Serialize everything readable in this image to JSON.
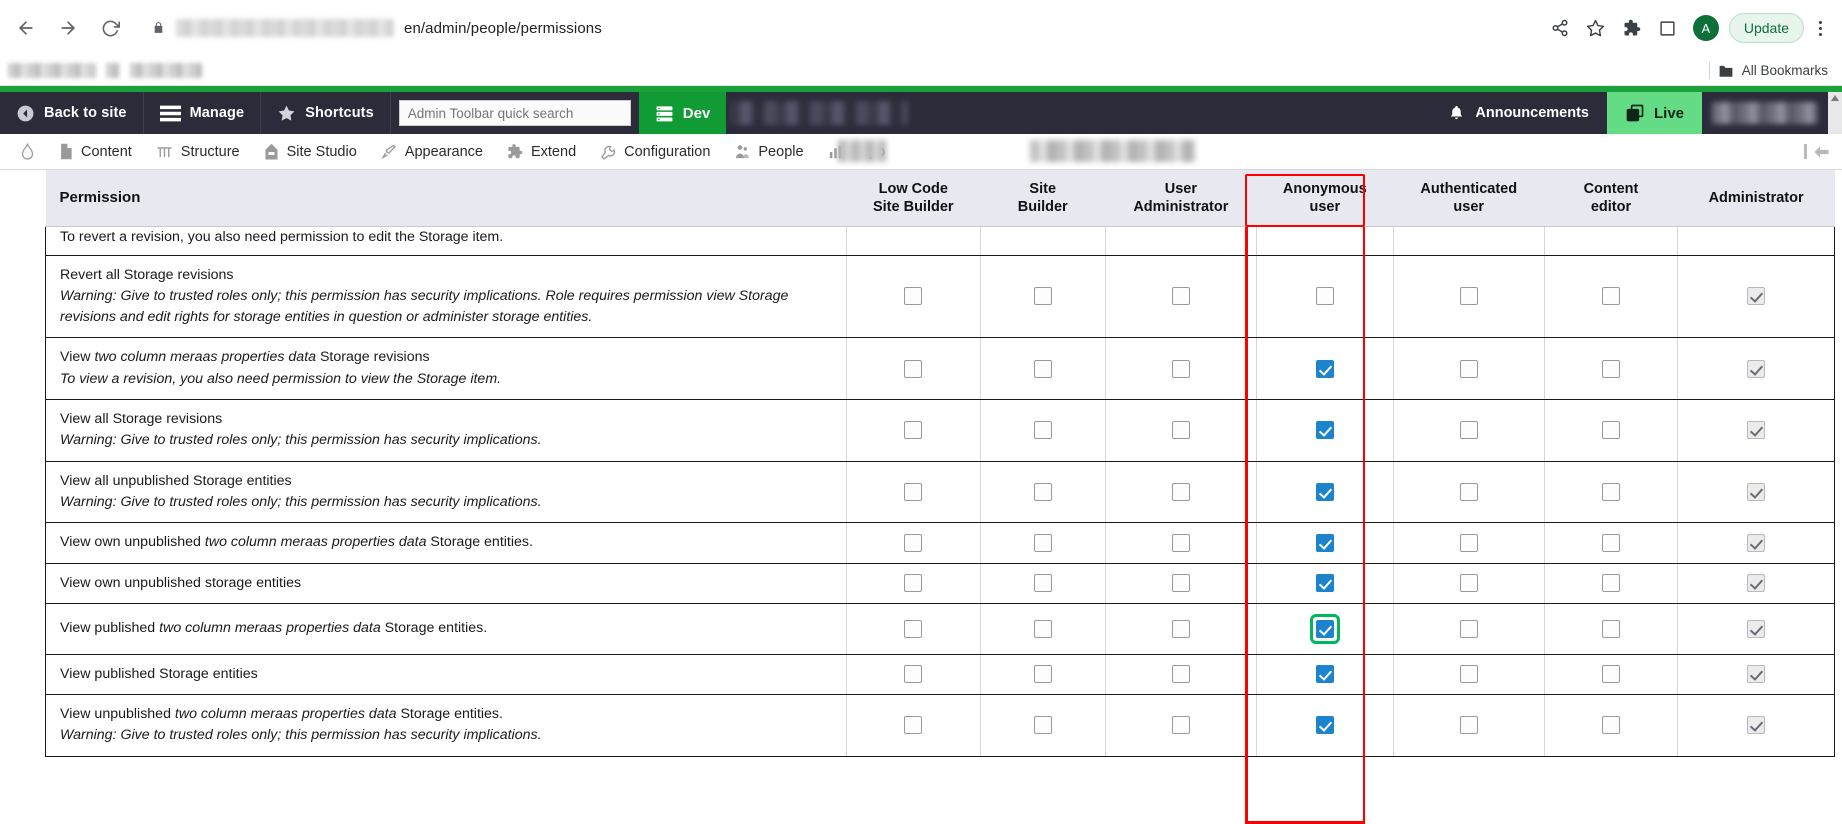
{
  "browser": {
    "back_icon": "back-arrow-icon",
    "forward_icon": "forward-arrow-icon",
    "reload_icon": "reload-icon",
    "lock_icon": "lock-icon",
    "url_visible_text": "en/admin/people/permissions",
    "share_icon": "share-icon",
    "bookmark_icon": "star-icon",
    "extensions_icon": "puzzle-piece-icon",
    "sidepanel_icon": "side-panel-icon",
    "profile_initial": "A",
    "update_label": "Update",
    "menu_icon": "three-dot-menu-icon",
    "all_bookmarks_label": "All Bookmarks",
    "folder_icon": "folder-icon"
  },
  "admin_toolbar": {
    "back_to_site": "Back to site",
    "back_icon": "back-circle-icon",
    "manage": "Manage",
    "manage_icon": "hamburger-icon",
    "shortcuts": "Shortcuts",
    "shortcuts_icon": "star-icon",
    "search_placeholder": "Admin Toolbar quick search",
    "search_value": "",
    "environment": "Dev",
    "environment_icon": "server-stack-icon",
    "announcements": "Announcements",
    "announcements_icon": "bell-icon",
    "live": "Live",
    "live_icon": "copy-layers-icon"
  },
  "nav": {
    "logo_icon": "drupal-drop-icon",
    "items": [
      {
        "label": "Content",
        "icon": "file-icon"
      },
      {
        "label": "Structure",
        "icon": "structure-icon"
      },
      {
        "label": "Site Studio",
        "icon": "site-studio-icon"
      },
      {
        "label": "Appearance",
        "icon": "paintbrush-icon"
      },
      {
        "label": "Extend",
        "icon": "puzzle-icon"
      },
      {
        "label": "Configuration",
        "icon": "wrench-icon"
      },
      {
        "label": "People",
        "icon": "people-icon"
      },
      {
        "label": "Repo",
        "icon": "bar-chart-icon"
      }
    ],
    "collapse_icon": "collapse-left-arrow-icon"
  },
  "table": {
    "columns": [
      "Permission",
      "Low Code\nSite Builder",
      "Site\nBuilder",
      "User\nAdministrator",
      "Anonymous\nuser",
      "Authenticated\nuser",
      "Content\neditor",
      "Administrator"
    ],
    "highlight_column": "Anonymous user",
    "highlight_color": "#ff0000",
    "focus_ring_color": "#00b65e",
    "checked_color": "#1b84cc",
    "partial_top_row": {
      "text": "To revert a revision, you also need permission to edit the Storage item."
    },
    "rows": [
      {
        "title": "Revert all Storage revisions",
        "description": "Warning: Give to trusted roles only; this permission has security implications. Role requires permission view Storage revisions and edit rights for storage entities in question or administer storage entities.",
        "has_description": true,
        "states": [
          "unchecked",
          "unchecked",
          "unchecked",
          "unchecked",
          "unchecked",
          "unchecked",
          "disabled-checked"
        ],
        "focused_index": -1
      },
      {
        "title": "View two column meraas properties data Storage revisions",
        "description": "To view a revision, you also need permission to view the Storage item.",
        "has_description": true,
        "states": [
          "unchecked",
          "unchecked",
          "unchecked",
          "checked",
          "unchecked",
          "unchecked",
          "disabled-checked"
        ],
        "focused_index": -1
      },
      {
        "title": "View all Storage revisions",
        "description": "Warning: Give to trusted roles only; this permission has security implications.",
        "has_description": true,
        "states": [
          "unchecked",
          "unchecked",
          "unchecked",
          "checked",
          "unchecked",
          "unchecked",
          "disabled-checked"
        ],
        "focused_index": -1
      },
      {
        "title": "View all unpublished Storage entities",
        "description": "Warning: Give to trusted roles only; this permission has security implications.",
        "has_description": true,
        "states": [
          "unchecked",
          "unchecked",
          "unchecked",
          "checked",
          "unchecked",
          "unchecked",
          "disabled-checked"
        ],
        "focused_index": -1
      },
      {
        "title": "View own unpublished two column meraas properties data Storage entities.",
        "description": "",
        "has_description": false,
        "states": [
          "unchecked",
          "unchecked",
          "unchecked",
          "checked",
          "unchecked",
          "unchecked",
          "disabled-checked"
        ],
        "focused_index": -1
      },
      {
        "title": "View own unpublished storage entities",
        "description": "",
        "has_description": false,
        "states": [
          "unchecked",
          "unchecked",
          "unchecked",
          "checked",
          "unchecked",
          "unchecked",
          "disabled-checked"
        ],
        "focused_index": -1
      },
      {
        "title": "View published two column meraas properties data Storage entities.",
        "description": "",
        "has_description": false,
        "states": [
          "unchecked",
          "unchecked",
          "unchecked",
          "checked",
          "unchecked",
          "unchecked",
          "disabled-checked"
        ],
        "focused_index": 3
      },
      {
        "title": "View published Storage entities",
        "description": "",
        "has_description": false,
        "states": [
          "unchecked",
          "unchecked",
          "unchecked",
          "checked",
          "unchecked",
          "unchecked",
          "disabled-checked"
        ],
        "focused_index": -1
      },
      {
        "title": "View unpublished two column meraas properties data Storage entities.",
        "description": "Warning: Give to trusted roles only; this permission has security implications.",
        "has_description": true,
        "states": [
          "unchecked",
          "unchecked",
          "unchecked",
          "checked",
          "unchecked",
          "unchecked",
          "disabled-checked"
        ],
        "focused_index": -1
      }
    ]
  }
}
